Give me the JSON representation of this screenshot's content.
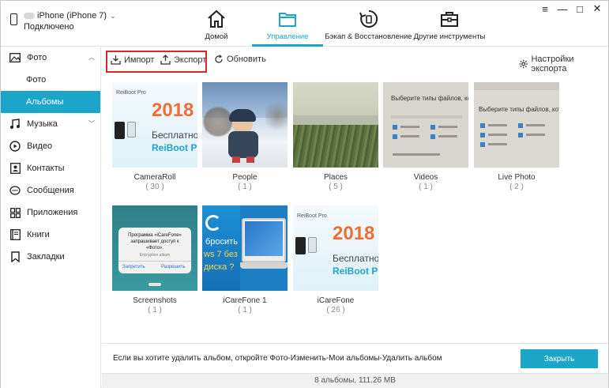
{
  "device": {
    "name": "iPhone (iPhone 7)",
    "status": "Подключено"
  },
  "nav": {
    "tabs": [
      {
        "label": "Домой",
        "icon": "home-icon"
      },
      {
        "label": "Управление",
        "icon": "folder-icon"
      },
      {
        "label": "Бэкап & Восстановление",
        "icon": "backup-icon"
      },
      {
        "label": "Другие инструменты",
        "icon": "toolbox-icon"
      }
    ],
    "active_tab": "Управление"
  },
  "sidebar": {
    "items": [
      {
        "label": "Фото",
        "icon": "photo-icon"
      },
      {
        "label": "Фото"
      },
      {
        "label": "Альбомы"
      },
      {
        "label": "Музыка",
        "icon": "music-icon"
      },
      {
        "label": "Видео",
        "icon": "video-icon"
      },
      {
        "label": "Контакты",
        "icon": "contacts-icon"
      },
      {
        "label": "Сообщения",
        "icon": "messages-icon"
      },
      {
        "label": "Приложения",
        "icon": "apps-icon"
      },
      {
        "label": "Книги",
        "icon": "books-icon"
      },
      {
        "label": "Закладки",
        "icon": "bookmark-icon"
      }
    ],
    "selected": "Альбомы"
  },
  "toolbar": {
    "import_label": "Импорт",
    "export_label": "Экспорт",
    "refresh_label": "Обновить",
    "export_settings_label": "Настройки экспорта"
  },
  "albums": [
    {
      "name": "CameraRoll",
      "count": "( 30 )"
    },
    {
      "name": "People",
      "count": "( 1 )"
    },
    {
      "name": "Places",
      "count": "( 5 )"
    },
    {
      "name": "Videos",
      "count": "( 1 )"
    },
    {
      "name": "Live Photo",
      "count": "( 2 )"
    },
    {
      "name": "Screenshots",
      "count": "( 1 )"
    },
    {
      "name": "iCareFone 1",
      "count": "( 1 )"
    },
    {
      "name": "iCareFone",
      "count": "( 26 )"
    }
  ],
  "thumb_text": {
    "reiboot_brand": "ReiBoot Pro",
    "reiboot_year": "2018",
    "reiboot_line1": "Бесплатно ск",
    "reiboot_line2": "ReiBoot P",
    "files_title": "Выберите типы файлов, котор",
    "dialog_title": "Программа «iCareFone» запрашивает доступ к «Фото».",
    "dialog_sub": "Encryption album",
    "dialog_deny": "Запретить",
    "dialog_allow": "Разрешить",
    "icf_line1": "бросить",
    "icf_line2": "ws 7 без",
    "icf_line3": "диска ?"
  },
  "bottom": {
    "hint": "Если вы хотите удалить альбом, откройте Фото-Изменить-Мои альбомы-Удалить альбом",
    "close_label": "Закрыть",
    "status": "8 альбомы, 111.26 MB"
  },
  "colors": {
    "accent": "#1ba6c9",
    "highlight_border": "#d12a2a"
  }
}
